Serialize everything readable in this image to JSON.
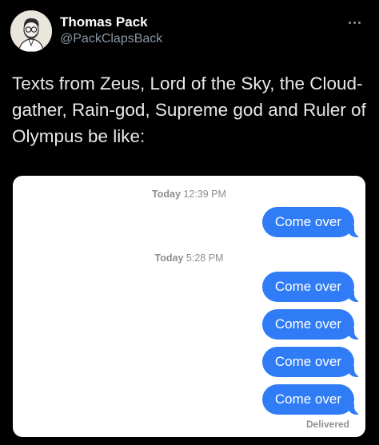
{
  "author": {
    "name": "Thomas Pack",
    "handle": "@PackClapsBack"
  },
  "tweet": {
    "text": "Texts from Zeus, Lord of the Sky, the Cloud-gather, Rain-god, Supreme god and Ruler of Olympus be like:"
  },
  "imessage": {
    "timestamps": [
      {
        "day": "Today",
        "time": "12:39 PM"
      },
      {
        "day": "Today",
        "time": "5:28 PM"
      }
    ],
    "messages": [
      {
        "text": "Come over"
      },
      {
        "text": "Come over"
      },
      {
        "text": "Come over"
      },
      {
        "text": "Come over"
      },
      {
        "text": "Come over"
      }
    ],
    "status": "Delivered"
  },
  "icons": {
    "more": "more-horizontal-icon",
    "avatar": "profile-avatar"
  },
  "colors": {
    "background": "#000000",
    "bubble": "#2f7cf6",
    "handle": "#8b98a5"
  }
}
